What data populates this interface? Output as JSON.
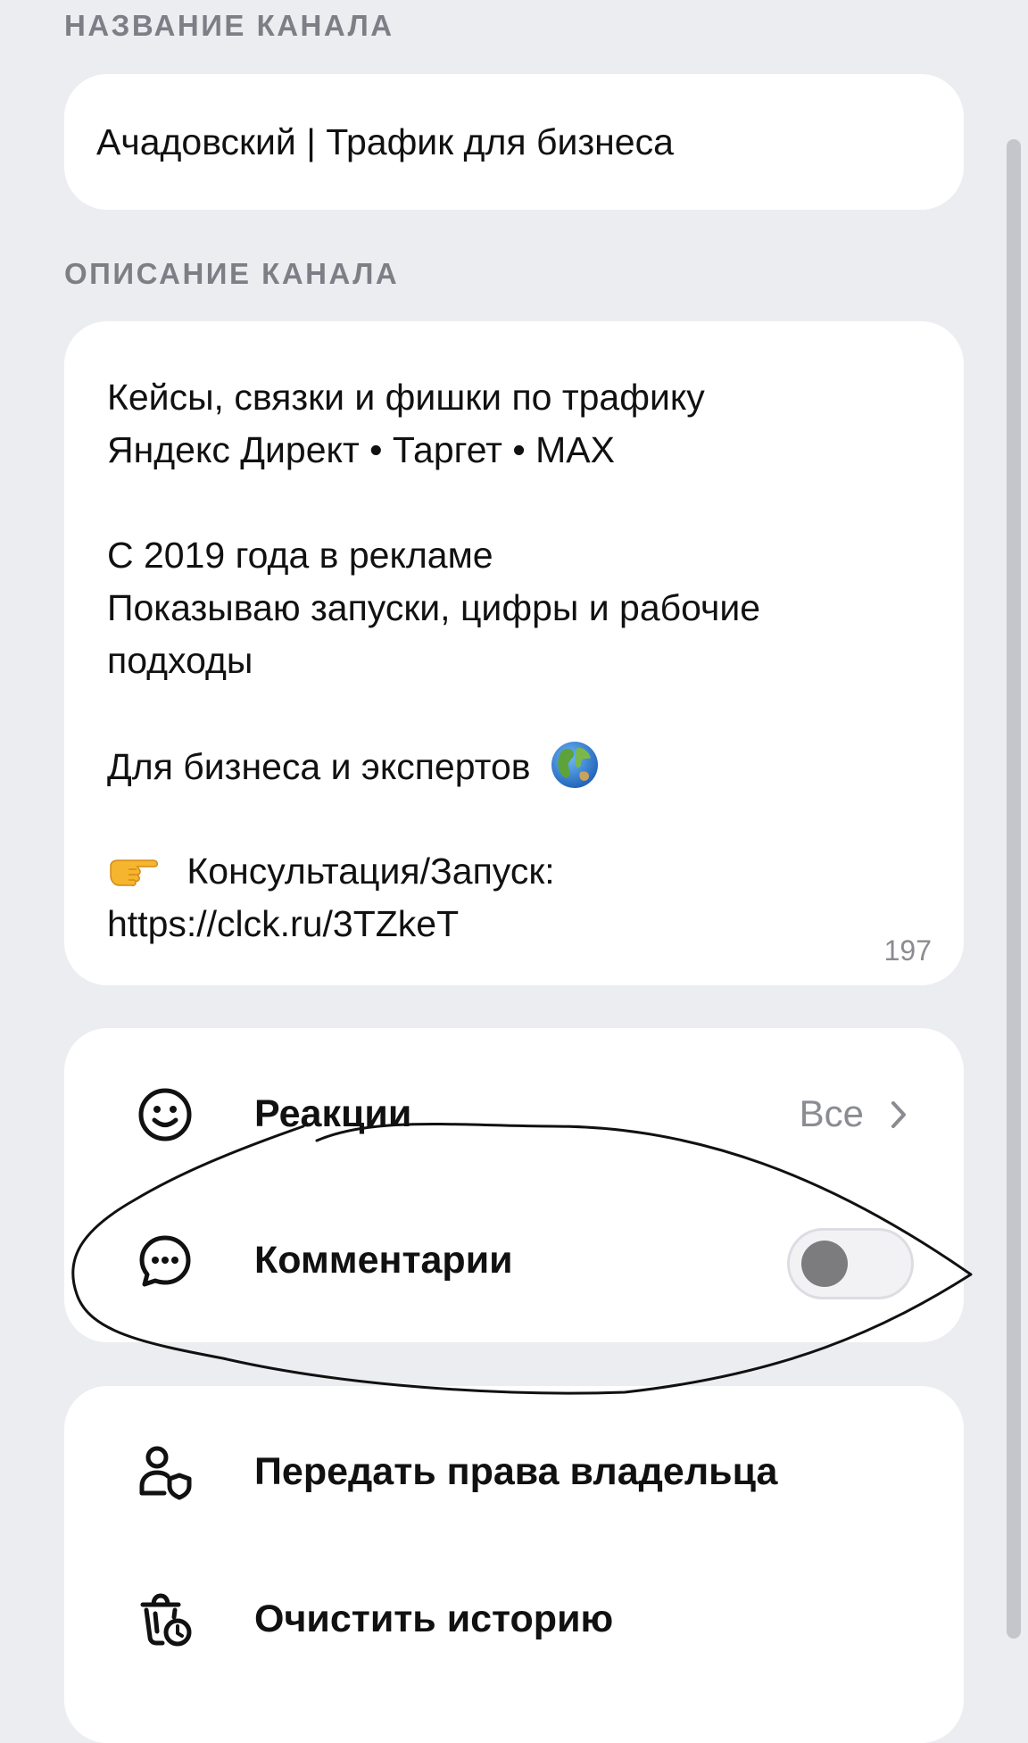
{
  "channel_name": {
    "section_label": "НАЗВАНИЕ КАНАЛА",
    "value": "Ачадовский | Трафик для бизнеса"
  },
  "channel_description": {
    "section_label": "ОПИСАНИЕ КАНАЛА",
    "lines": [
      "Кейсы, связки и фишки по трафику",
      "Яндекс Директ • Таргет • MAX",
      "",
      "С 2019 года в рекламе",
      "Показываю запуски, цифры и рабочие",
      "подходы",
      "",
      "Для бизнеса и экспертов",
      "",
      "Консультация/Запуск:",
      "https://clck.ru/3TZkeT"
    ],
    "char_count": "197",
    "icons": [
      "globe-icon",
      "pointing-hand-icon"
    ]
  },
  "settings": {
    "reactions": {
      "label": "Реакции",
      "value": "Все",
      "icon": "smiley-icon"
    },
    "comments": {
      "label": "Комментарии",
      "enabled": false,
      "icon": "chat-bubble-icon"
    }
  },
  "actions": {
    "transfer_owner": {
      "label": "Передать права владельца",
      "icon": "user-shield-icon"
    },
    "clear_history": {
      "label": "Очистить историю",
      "icon": "trash-clock-icon"
    }
  },
  "colors": {
    "background": "#ECEDF1",
    "card": "#FFFFFF",
    "section_label": "#7D7F86",
    "secondary_text": "#8A8C92",
    "toggle_knob": "#7C7C7F"
  }
}
